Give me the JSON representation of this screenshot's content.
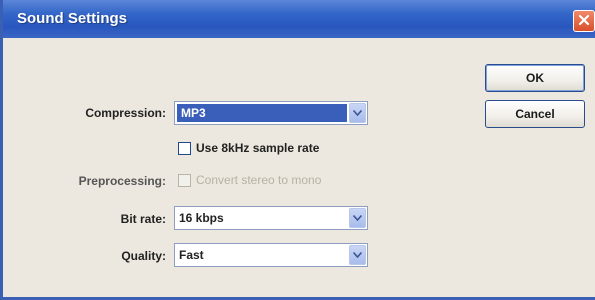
{
  "window": {
    "title": "Sound Settings",
    "close_icon": "close-icon"
  },
  "buttons": {
    "ok_label": "OK",
    "cancel_label": "Cancel"
  },
  "compression": {
    "label": "Compression:",
    "value": "MP3"
  },
  "sample_rate_option": {
    "label": "Use 8kHz sample rate",
    "checked": false
  },
  "preprocessing": {
    "label": "Preprocessing:",
    "option_label": "Convert stereo to mono",
    "enabled": false
  },
  "bit_rate": {
    "label": "Bit rate:",
    "value": "16 kbps"
  },
  "quality": {
    "label": "Quality:",
    "value": "Fast"
  },
  "colors": {
    "titlebar": "#2857bd",
    "selection": "#3a5fba",
    "close": "#d8502c"
  }
}
